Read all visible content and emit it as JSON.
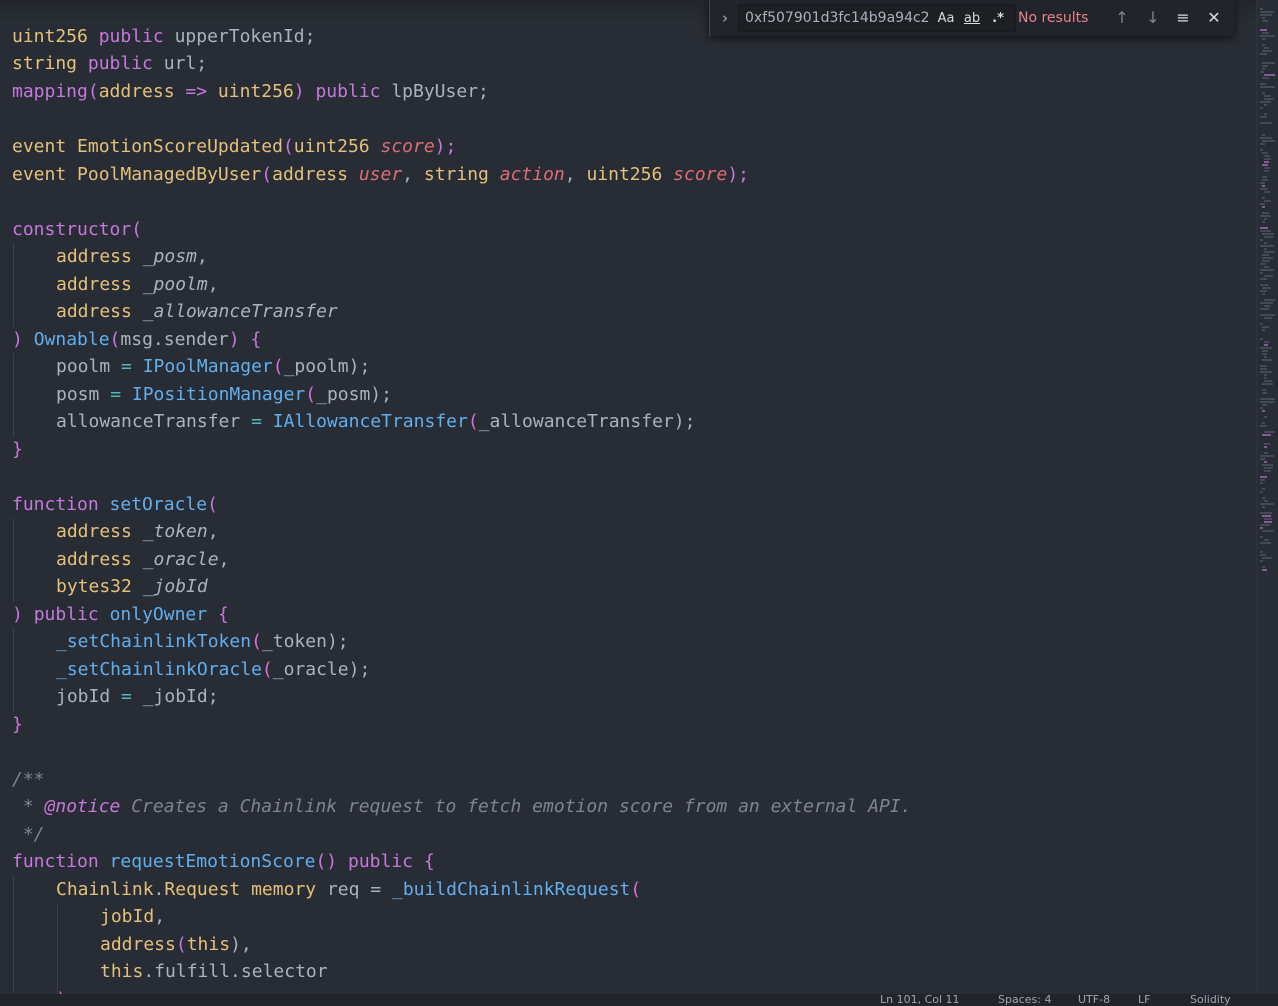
{
  "find_widget": {
    "query": "0xf507901d3fc14b9a94c2",
    "match_case_label": "Aa",
    "whole_word_label": "ab",
    "regex_label": ".*",
    "status": "No results",
    "prev_icon": "arrow-up-icon",
    "next_icon": "arrow-down-icon",
    "selection_icon": "find-in-selection-icon",
    "close_icon": "close-icon",
    "toggle_icon": "chevron-right-icon"
  },
  "code": {
    "l1": [
      "uint256",
      " ",
      "public",
      " upperTokenId;"
    ],
    "l2": [
      "string",
      " ",
      "public",
      " url;"
    ],
    "l3": [
      "mapping",
      "(",
      "address",
      " => ",
      "uint256",
      ")",
      " ",
      "public",
      " lpByUser;"
    ],
    "l5": [
      "event",
      " ",
      "EmotionScoreUpdated",
      "(",
      "uint256",
      " ",
      "score",
      ");"
    ],
    "l6": [
      "event",
      " ",
      "PoolManagedByUser",
      "(",
      "address",
      " ",
      "user",
      ", ",
      "string",
      " ",
      "action",
      ", ",
      "uint256",
      " ",
      "score",
      ");"
    ],
    "l8": [
      "constructor",
      "("
    ],
    "l9": [
      "address",
      " ",
      "_posm",
      ","
    ],
    "l10": [
      "address",
      " ",
      "_poolm",
      ","
    ],
    "l11": [
      "address",
      " ",
      "_allowanceTransfer"
    ],
    "l12": [
      ")",
      " ",
      "Ownable",
      "(",
      "msg.sender",
      ")",
      " ",
      "{"
    ],
    "l13": [
      "poolm",
      " = ",
      "IPoolManager",
      "(",
      "_poolm",
      ");"
    ],
    "l14": [
      "posm",
      " = ",
      "IPositionManager",
      "(",
      "_posm",
      ");"
    ],
    "l15": [
      "allowanceTransfer",
      " = ",
      "IAllowanceTransfer",
      "(",
      "_allowanceTransfer",
      ");"
    ],
    "l16": [
      "}"
    ],
    "l18": [
      "function",
      " ",
      "setOracle",
      "("
    ],
    "l19": [
      "address",
      " ",
      "_token",
      ","
    ],
    "l20": [
      "address",
      " ",
      "_oracle",
      ","
    ],
    "l21": [
      "bytes32",
      " ",
      "_jobId"
    ],
    "l22": [
      ")",
      " ",
      "public",
      " ",
      "onlyOwner",
      " ",
      "{"
    ],
    "l23": [
      "_setChainlinkToken",
      "(",
      "_token",
      ");"
    ],
    "l24": [
      "_setChainlinkOracle",
      "(",
      "_oracle",
      ");"
    ],
    "l25": [
      "jobId",
      " = ",
      "_jobId",
      ";"
    ],
    "l26": [
      "}"
    ],
    "l28": [
      "/**"
    ],
    "l29": [
      " * ",
      "@notice",
      " Creates a Chainlink request to fetch emotion score from an external API."
    ],
    "l30": [
      " */"
    ],
    "l31": [
      "function",
      " ",
      "requestEmotionScore",
      "()",
      " ",
      "public",
      " ",
      "{"
    ],
    "l32": [
      "Chainlink",
      ".",
      "Request",
      " ",
      "memory",
      " req = ",
      "_buildChainlinkRequest",
      "("
    ],
    "l33": [
      "jobId",
      ","
    ],
    "l34": [
      "address",
      "(",
      "this",
      "),"
    ],
    "l35": [
      "this",
      ".fulfill.selector"
    ],
    "l36": [
      ");"
    ]
  },
  "status_bar": {
    "position": "Ln 101, Col 11",
    "spaces": "Spaces: 4",
    "encoding": "UTF-8",
    "eol": "LF",
    "language": "Solidity"
  },
  "colors": {
    "background": "#282c34",
    "keyword": "#c678dd",
    "type": "#e5c07b",
    "function": "#61afef",
    "param": "#e06c75",
    "comment": "#7f848e",
    "find_status": "#e88388"
  }
}
